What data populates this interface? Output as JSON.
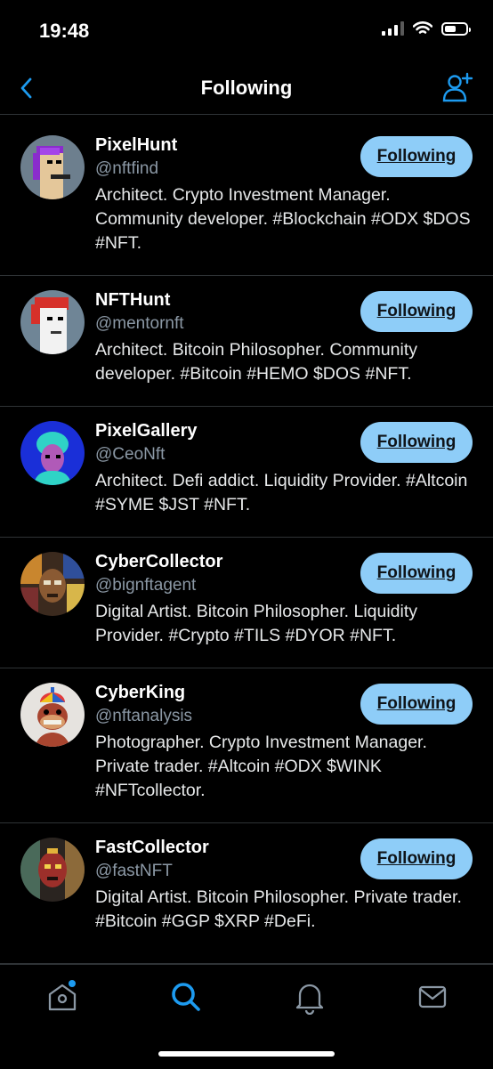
{
  "status_bar": {
    "time": "19:48",
    "battery_level": 0.55
  },
  "header": {
    "title": "Following",
    "back_icon": "chevron-left-icon",
    "add_icon": "add-user-icon",
    "accent": "#1d9bf0"
  },
  "follow_button_color": "#8ecdf8",
  "users": [
    {
      "name": "PixelHunt",
      "handle": "@nftfind",
      "bio": "Architect. Crypto Investment Manager. Community developer. #Blockchain #ODX $DOS #NFT.",
      "button": "Following"
    },
    {
      "name": "NFTHunt",
      "handle": "@mentornft",
      "bio": "Architect. Bitcoin Philosopher. Community developer. #Bitcoin #HEMO $DOS #NFT.",
      "button": "Following"
    },
    {
      "name": "PixelGallery",
      "handle": "@CeoNft",
      "bio": "Architect. Defi addict. Liquidity Provider. #Altcoin #SYME $JST #NFT.",
      "button": "Following"
    },
    {
      "name": "CyberCollector",
      "handle": "@bignftagent",
      "bio": "Digital Artist. Bitcoin Philosopher. Liquidity Provider. #Crypto #TILS #DYOR #NFT.",
      "button": "Following"
    },
    {
      "name": "CyberKing",
      "handle": "@nftanalysis",
      "bio": "Photographer. Crypto Investment Manager. Private trader. #Altcoin #ODX $WINK #NFTcollector.",
      "button": "Following"
    },
    {
      "name": "FastCollector",
      "handle": "@fastNFT",
      "bio": "Digital Artist. Bitcoin Philosopher. Private trader. #Bitcoin #GGP $XRP #DeFi.",
      "button": "Following"
    }
  ],
  "tab_bar": {
    "tabs": [
      {
        "icon": "home-icon",
        "active": false,
        "notification_dot": true
      },
      {
        "icon": "search-icon",
        "active": true,
        "notification_dot": false
      },
      {
        "icon": "bell-icon",
        "active": false,
        "notification_dot": false
      },
      {
        "icon": "mail-icon",
        "active": false,
        "notification_dot": false
      }
    ]
  }
}
